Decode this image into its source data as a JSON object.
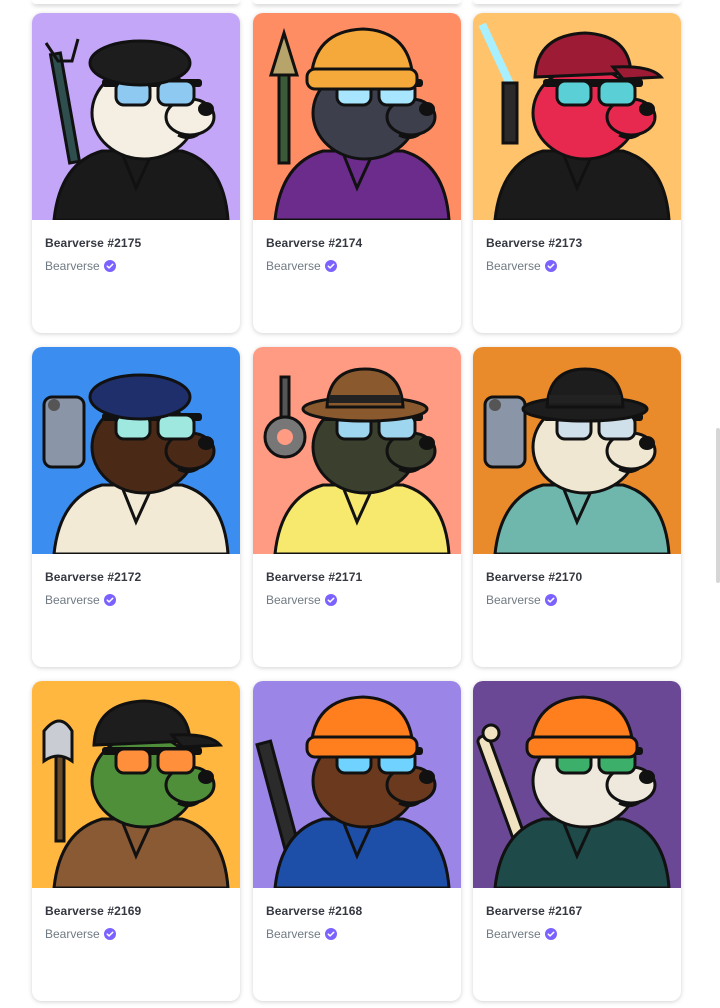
{
  "collection_name": "Bearverse",
  "verified_icon": "verified-badge-icon",
  "accent_color": "#7b61ff",
  "cards": [
    {
      "name": "Bearverse #2175",
      "collection": "Bearverse",
      "bg": "#c3a6f7",
      "head": "#f4efe2",
      "hat": "#1d1d1d",
      "glasses": "#8ec9f2",
      "body": "#1a1a1a",
      "hatType": "beret",
      "weapon": "claw"
    },
    {
      "name": "Bearverse #2174",
      "collection": "Bearverse",
      "bg": "#ff8d63",
      "head": "#3d3f4d",
      "hat": "#f4a93a",
      "glasses": "#a8e6ff",
      "body": "#6b2c8c",
      "hatType": "beanie",
      "weapon": "rocket"
    },
    {
      "name": "Bearverse #2173",
      "collection": "Bearverse",
      "bg": "#ffc36b",
      "head": "#e8294f",
      "hat": "#9d1b34",
      "glasses": "#5ad0d6",
      "body": "#1b1b1b",
      "hatType": "cap",
      "weapon": "saber"
    },
    {
      "name": "Bearverse #2172",
      "collection": "Bearverse",
      "bg": "#3b8ef0",
      "head": "#4a2a17",
      "hat": "#1f2f6b",
      "glasses": "#9ee8e0",
      "body": "#f3ead6",
      "hatType": "beret",
      "weapon": "gun"
    },
    {
      "name": "Bearverse #2171",
      "collection": "Bearverse",
      "bg": "#ff9a83",
      "head": "#3a3f2e",
      "hat": "#8a5a2e",
      "glasses": "#9ed6f0",
      "body": "#f7e96d",
      "hatType": "fedora",
      "weapon": "mace"
    },
    {
      "name": "Bearverse #2170",
      "collection": "Bearverse",
      "bg": "#e98b2a",
      "head": "#efe7d1",
      "hat": "#1d1d1d",
      "glasses": "#cfe0ea",
      "body": "#6fb6ad",
      "hatType": "fedora",
      "weapon": "gun"
    },
    {
      "name": "Bearverse #2169",
      "collection": "Bearverse",
      "bg": "#ffb73f",
      "head": "#4f8f3a",
      "hat": "#1d1d1d",
      "glasses": "#ff8f3a",
      "body": "#8a5a34",
      "hatType": "cap",
      "weapon": "axe"
    },
    {
      "name": "Bearverse #2168",
      "collection": "Bearverse",
      "bg": "#9b85e6",
      "head": "#6b3a1e",
      "hat": "#ff7f1f",
      "glasses": "#6fd2ff",
      "body": "#1e4fa8",
      "hatType": "beanie",
      "weapon": "rifle"
    },
    {
      "name": "Bearverse #2167",
      "collection": "Bearverse",
      "bg": "#6a4896",
      "head": "#efe9dd",
      "hat": "#ff7f1f",
      "glasses": "#3cb06a",
      "body": "#1f4a4a",
      "hatType": "beanie",
      "weapon": "bone"
    }
  ]
}
